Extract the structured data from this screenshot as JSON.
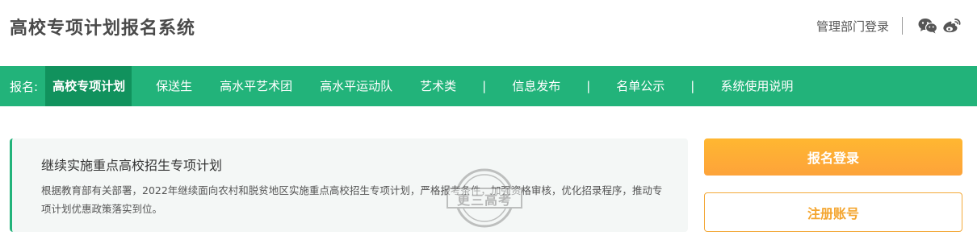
{
  "header": {
    "title": "高校专项计划报名系统",
    "admin_login": "管理部门登录",
    "icons": [
      "wechat-icon",
      "weibo-icon"
    ]
  },
  "nav": {
    "prefix": "报名:",
    "items": [
      {
        "label": "高校专项计划",
        "active": true
      },
      {
        "label": "保送生"
      },
      {
        "label": "高水平艺术团"
      },
      {
        "label": "高水平运动队"
      },
      {
        "label": "艺术类"
      },
      {
        "label": "信息发布"
      },
      {
        "label": "名单公示"
      },
      {
        "label": "系统使用说明"
      }
    ],
    "separator": "|"
  },
  "card": {
    "title": "继续实施重点高校招生专项计划",
    "body": "根据教育部有关部署，2022年继续面向农村和脱贫地区实施重点高校招生专项计划，严格报考条件，加强资格审核，优化招录程序，推动专项计划优惠政策落实到位。"
  },
  "watermark": {
    "text": "更三高考"
  },
  "actions": {
    "login": "报名登录",
    "register": "注册账号"
  },
  "colors": {
    "brand_green": "#22b37a",
    "active_green": "#11925d",
    "orange": "#fda33a"
  }
}
